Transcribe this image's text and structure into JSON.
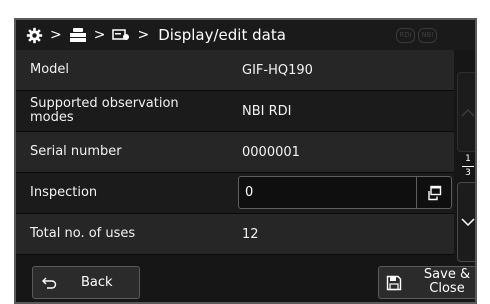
{
  "header": {
    "icons": [
      "gear-icon",
      "processor-icon",
      "scope-icon"
    ],
    "separator": ">",
    "title": "Display/edit data",
    "mode_badges": [
      "RDI",
      "NBI"
    ]
  },
  "rows": [
    {
      "label": "Model",
      "value": "GIF-HQ190"
    },
    {
      "label": "Supported observation modes",
      "value": "NBI RDI"
    },
    {
      "label": "Serial number",
      "value": "0000001"
    },
    {
      "label": "Inspection",
      "value": "0",
      "edit_icon": "popup-window-icon"
    },
    {
      "label": "Total no. of uses",
      "value": "12"
    }
  ],
  "pager": {
    "current": "1",
    "total": "3"
  },
  "footer": {
    "back_label": "Back",
    "save_label": "Save &\nClose"
  },
  "colors": {
    "background": "#161616",
    "row_light": "#262626",
    "row_dark": "#1b1b1b",
    "text": "#f2f2f2"
  }
}
